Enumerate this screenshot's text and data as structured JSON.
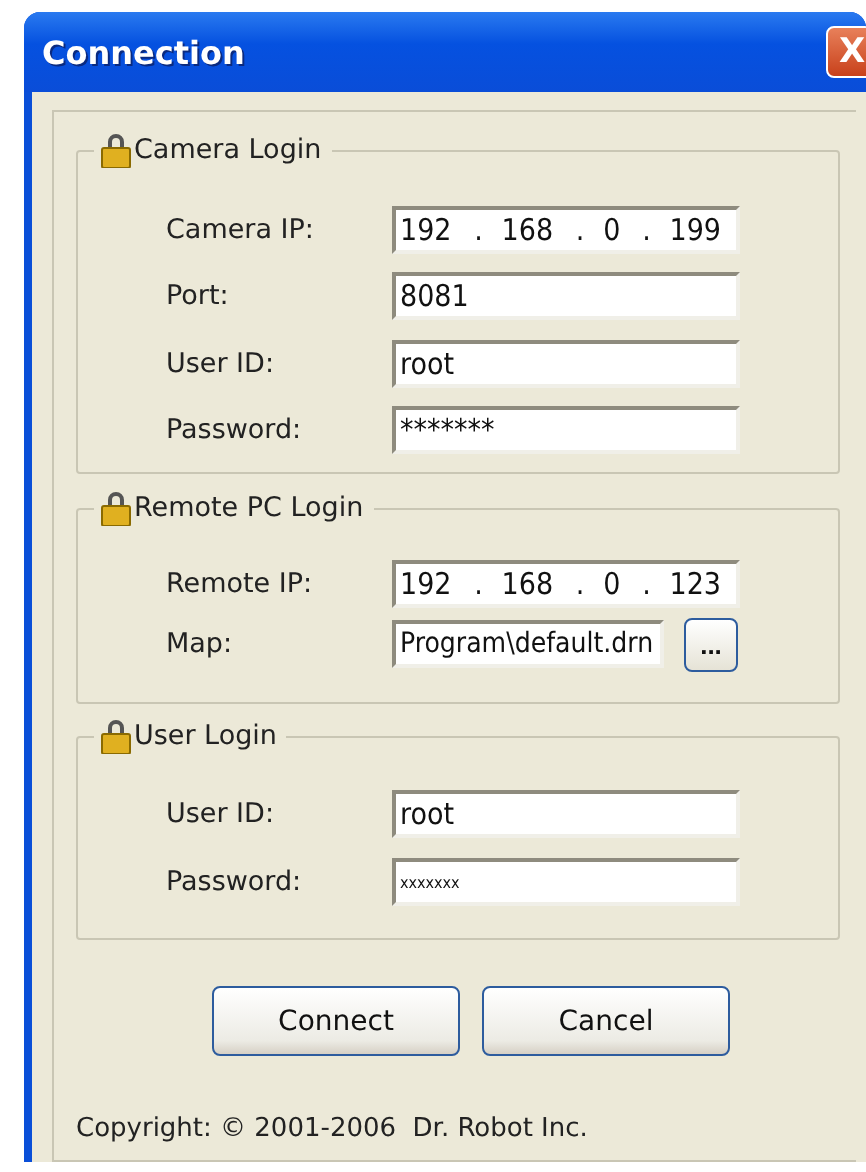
{
  "window": {
    "title": "Connection",
    "close_symbol": "X"
  },
  "groups": [
    {
      "title": "Camera Login",
      "rows": [
        {
          "label": "Camera IP:",
          "kind": "ip",
          "separator": ".",
          "octets": [
            "192",
            "168",
            "0",
            "199"
          ]
        },
        {
          "label": "Port:",
          "kind": "text",
          "value": "8081"
        },
        {
          "label": "User ID:",
          "kind": "text",
          "value": "root"
        },
        {
          "label": "Password:",
          "kind": "password",
          "value": "*******"
        }
      ]
    },
    {
      "title": "Remote PC Login",
      "rows": [
        {
          "label": "Remote IP:",
          "kind": "ip",
          "separator": ".",
          "octets": [
            "192",
            "168",
            "0",
            "123"
          ]
        },
        {
          "label": "Map:",
          "kind": "path",
          "value": "Program\\default.drn",
          "button": "..."
        }
      ]
    },
    {
      "title": "User Login",
      "rows": [
        {
          "label": "User ID:",
          "kind": "text",
          "value": "root"
        },
        {
          "label": "Password:",
          "kind": "password_small",
          "value": "xxxxxxx"
        }
      ]
    }
  ],
  "buttons": [
    "Connect",
    "Cancel"
  ],
  "copyright": "Copyright: © 2001-2006  Dr. Robot Inc."
}
